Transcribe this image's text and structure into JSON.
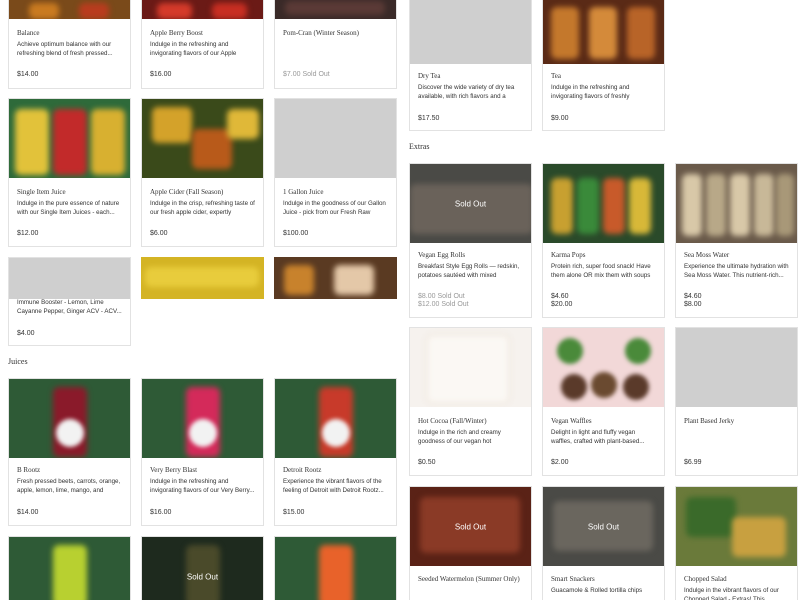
{
  "sections": {
    "juices": "Juices",
    "extras": "Extras"
  },
  "sold_out_label": "Sold Out",
  "cards": {
    "balance": {
      "title": "Balance",
      "desc": "Achieve optimum balance with our refreshing blend of fresh pressed...",
      "price": "$14.00"
    },
    "apple_berry_boost": {
      "title": "Apple Berry Boost",
      "desc": "Indulge in the refreshing and invigorating flavors of our Apple Berry...",
      "price": "$16.00"
    },
    "pom_cran": {
      "title": "Pom-Cran (Winter Season)",
      "price": "$7.00",
      "sold": "Sold Out"
    },
    "dry_tea": {
      "title": "Dry Tea",
      "desc": "Discover the wide variety of dry tea available, with rich flavors and a rang...",
      "price": "$17.50"
    },
    "tea": {
      "title": "Tea",
      "desc": "Indulge in the refreshing and invigorating flavors of freshly brewed...",
      "price": "$9.00"
    },
    "single_item_juice": {
      "title": "Single Item Juice",
      "desc": "Indulge in the pure essence of nature with our Single Item Juices - each...",
      "price": "$12.00"
    },
    "apple_cider": {
      "title": "Apple Cider (Fall Season)",
      "desc": "Indulge in the crisp, refreshing taste of our fresh apple cider, expertly crafted...",
      "price": "$6.00"
    },
    "gallon_juice": {
      "title": "1 Gallon Juice",
      "desc": "Indulge in the goodness of our Gallon Juice - pick from our Fresh Raw Juice...",
      "price": "$100.00"
    },
    "immune_booster": {
      "desc": "Immune Booster - Lemon, Lime Cayanne Pepper, Ginger ACV - ACV...",
      "price": "$4.00"
    },
    "vegan_egg_rolls": {
      "title": "Vegan Egg Rolls",
      "desc": "Breakfast Style Egg Rolls — redskin, potatoes sautéed with mixed peppers...",
      "price": "$8.00",
      "price2": "$12.00",
      "sold": "Sold Out",
      "sold2": "Sold Out"
    },
    "karma_pops": {
      "title": "Karma Pops",
      "desc": "Protein rich, super food snack! Have them alone OR mix them with soups o...",
      "price": "$4.60",
      "price2": "$20.00"
    },
    "sea_moss_water": {
      "title": "Sea Moss Water",
      "desc": "Experience the ultimate hydration with Sea Moss Water. This nutrient-rich...",
      "price": "$4.60",
      "price2": "$8.00"
    },
    "b_rootz": {
      "title": "B Rootz",
      "desc": "Fresh pressed beets, carrots, orange, apple, lemon, lime, mango, and ginge...",
      "price": "$14.00"
    },
    "very_berry_blast": {
      "title": "Very Berry Blast",
      "desc": "Indulge in the refreshing and invigorating flavors of our Very Berry...",
      "price": "$16.00"
    },
    "detroit_rootz": {
      "title": "Detroit Rootz",
      "desc": "Experience the vibrant flavors of the feeling of Detroit with Detroit Rootz...",
      "price": "$15.00"
    },
    "hot_cocoa": {
      "title": "Hot Cocoa (Fall/Winter)",
      "desc": "Indulge in the rich and creamy goodness of our vegan hot chocolate...",
      "price": "$0.50"
    },
    "vegan_waffles": {
      "title": "Vegan Waffles",
      "desc": "Delight in light and fluffy vegan waffles, crafted with plant-based...",
      "price": "$2.00"
    },
    "plant_based_jerky": {
      "title": "Plant Based Jerky",
      "price": "$6.99"
    },
    "seeded_watermelon": {
      "title": "Seeded Watermelon (Summer Only)"
    },
    "smart_snackers": {
      "title": "Smart Snackers",
      "desc": "Guacamole & Rolled tortilla chips"
    },
    "chopped_salad": {
      "title": "Chopped Salad",
      "desc": "Indulge in the vibrant flavors of our Chopped Salad - Extras! This..."
    }
  },
  "colors": {
    "border": "#e2e2e2",
    "text": "#333333",
    "muted": "#999999",
    "placeholder": "#cfcfcf"
  }
}
